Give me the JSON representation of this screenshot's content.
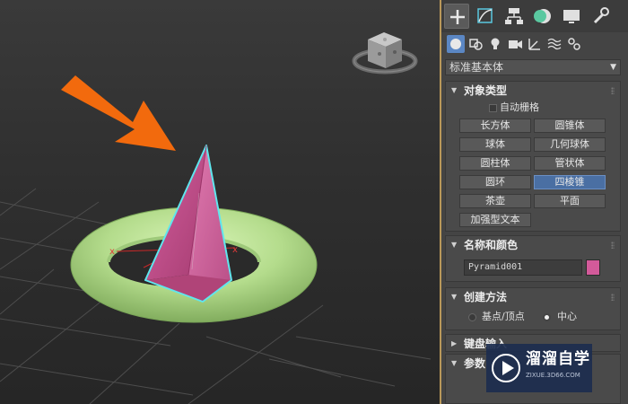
{
  "toolbar_tabs": [
    {
      "name": "create-icon",
      "active": true
    },
    {
      "name": "modify-icon",
      "active": false
    },
    {
      "name": "hierarchy-icon",
      "active": false
    },
    {
      "name": "motion-icon",
      "active": false
    },
    {
      "name": "display-icon",
      "active": false
    },
    {
      "name": "utilities-icon",
      "active": false
    }
  ],
  "category_icons": [
    {
      "name": "geometry-icon",
      "active": true
    },
    {
      "name": "shapes-icon",
      "active": false
    },
    {
      "name": "lights-icon",
      "active": false
    },
    {
      "name": "cameras-icon",
      "active": false
    },
    {
      "name": "helpers-icon",
      "active": false
    },
    {
      "name": "space-warps-icon",
      "active": false
    },
    {
      "name": "systems-icon",
      "active": false
    }
  ],
  "dropdown": {
    "value": "标准基本体"
  },
  "object_type": {
    "title": "对象类型",
    "autogrid": "自动栅格",
    "buttons": [
      "长方体",
      "圆锥体",
      "球体",
      "几何球体",
      "圆柱体",
      "管状体",
      "圆环",
      "四棱锥",
      "茶壶",
      "平面",
      "加强型文本"
    ],
    "selected": "四棱锥"
  },
  "name_color": {
    "title": "名称和颜色",
    "name_value": "Pyramid001",
    "color": "#d35a9a"
  },
  "creation_method": {
    "title": "创建方法",
    "option_base": "基点/顶点",
    "option_center": "中心",
    "selected": "中心"
  },
  "keyboard_entry": {
    "title": "键盘输入"
  },
  "parameters": {
    "title": "参数"
  },
  "watermark": {
    "name": "溜溜自学",
    "url": "ZIXUE.3D66.COM"
  },
  "colors": {
    "panel_bg": "#444444",
    "accent_border": "#b9985a",
    "selected_button": "#4a6fa3",
    "torus": "#b4dc8c",
    "pyramid": "#c2457f",
    "selection_outline": "#5fe6ee",
    "arrow": "#f26a0d"
  }
}
